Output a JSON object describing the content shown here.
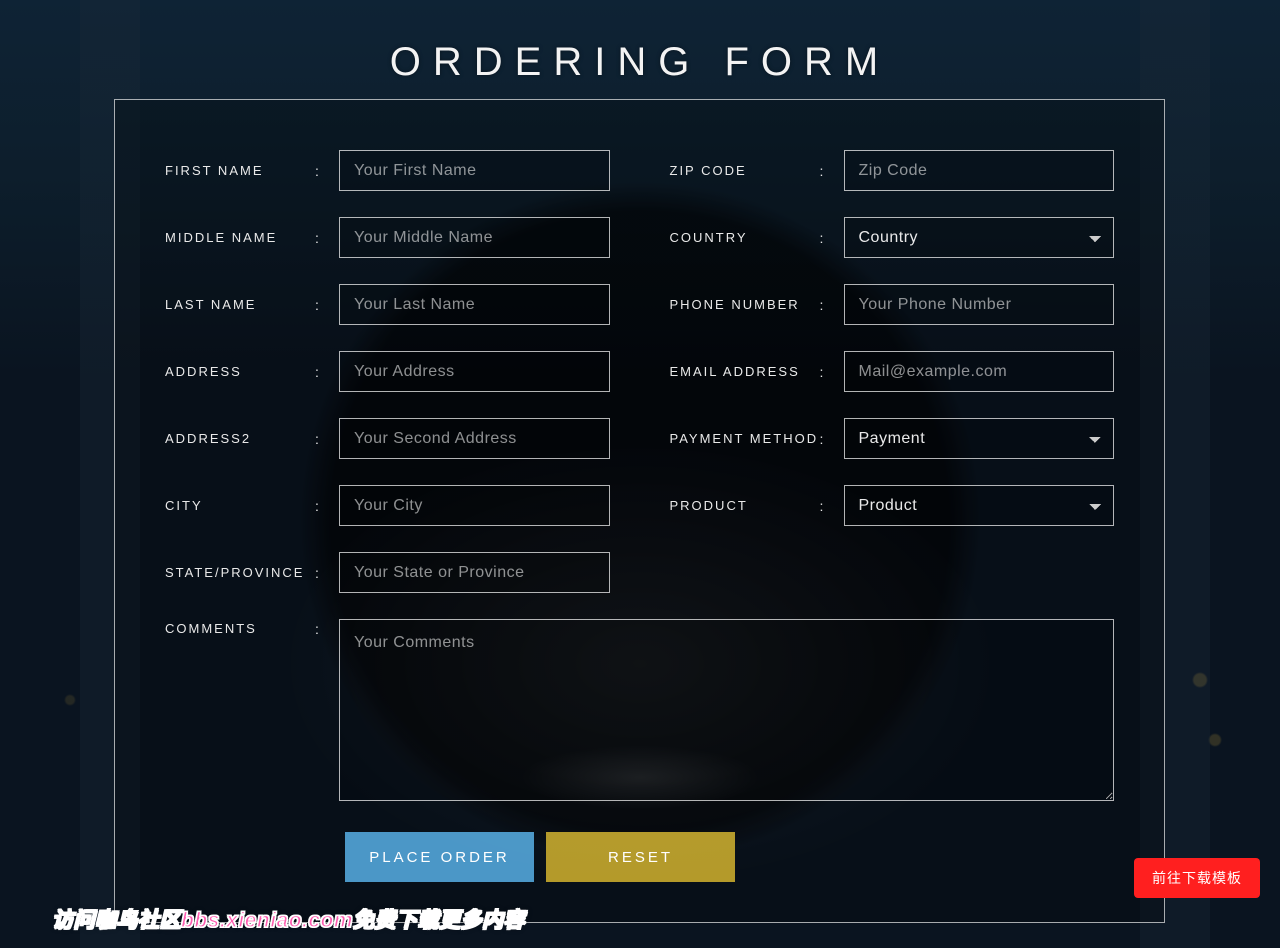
{
  "title": "ORDERING FORM",
  "labels": {
    "first_name": "FIRST NAME",
    "middle_name": "MIDDLE NAME",
    "last_name": "LAST NAME",
    "address": "ADDRESS",
    "address2": "ADDRESS2",
    "city": "CITY",
    "state": "STATE/PROVINCE",
    "zip": "ZIP CODE",
    "country": "COUNTRY",
    "phone": "PHONE NUMBER",
    "email": "EMAIL ADDRESS",
    "payment": "PAYMENT METHOD",
    "product": "PRODUCT",
    "comments": "COMMENTS",
    "colon": ":"
  },
  "placeholders": {
    "first_name": "Your First Name",
    "middle_name": "Your Middle Name",
    "last_name": "Your Last Name",
    "address": "Your Address",
    "address2": "Your Second Address",
    "city": "Your City",
    "state": "Your State or Province",
    "zip": "Zip Code",
    "phone": "Your Phone Number",
    "email": "Mail@example.com",
    "comments": "Your Comments"
  },
  "selects": {
    "country": "Country",
    "payment": "Payment",
    "product": "Product"
  },
  "buttons": {
    "submit": "PLACE ORDER",
    "reset": "RESET"
  },
  "floating_button": "前往下载模板",
  "watermark": "访问咖鸟社区bbs.xieniao.com免费下载更多内容"
}
